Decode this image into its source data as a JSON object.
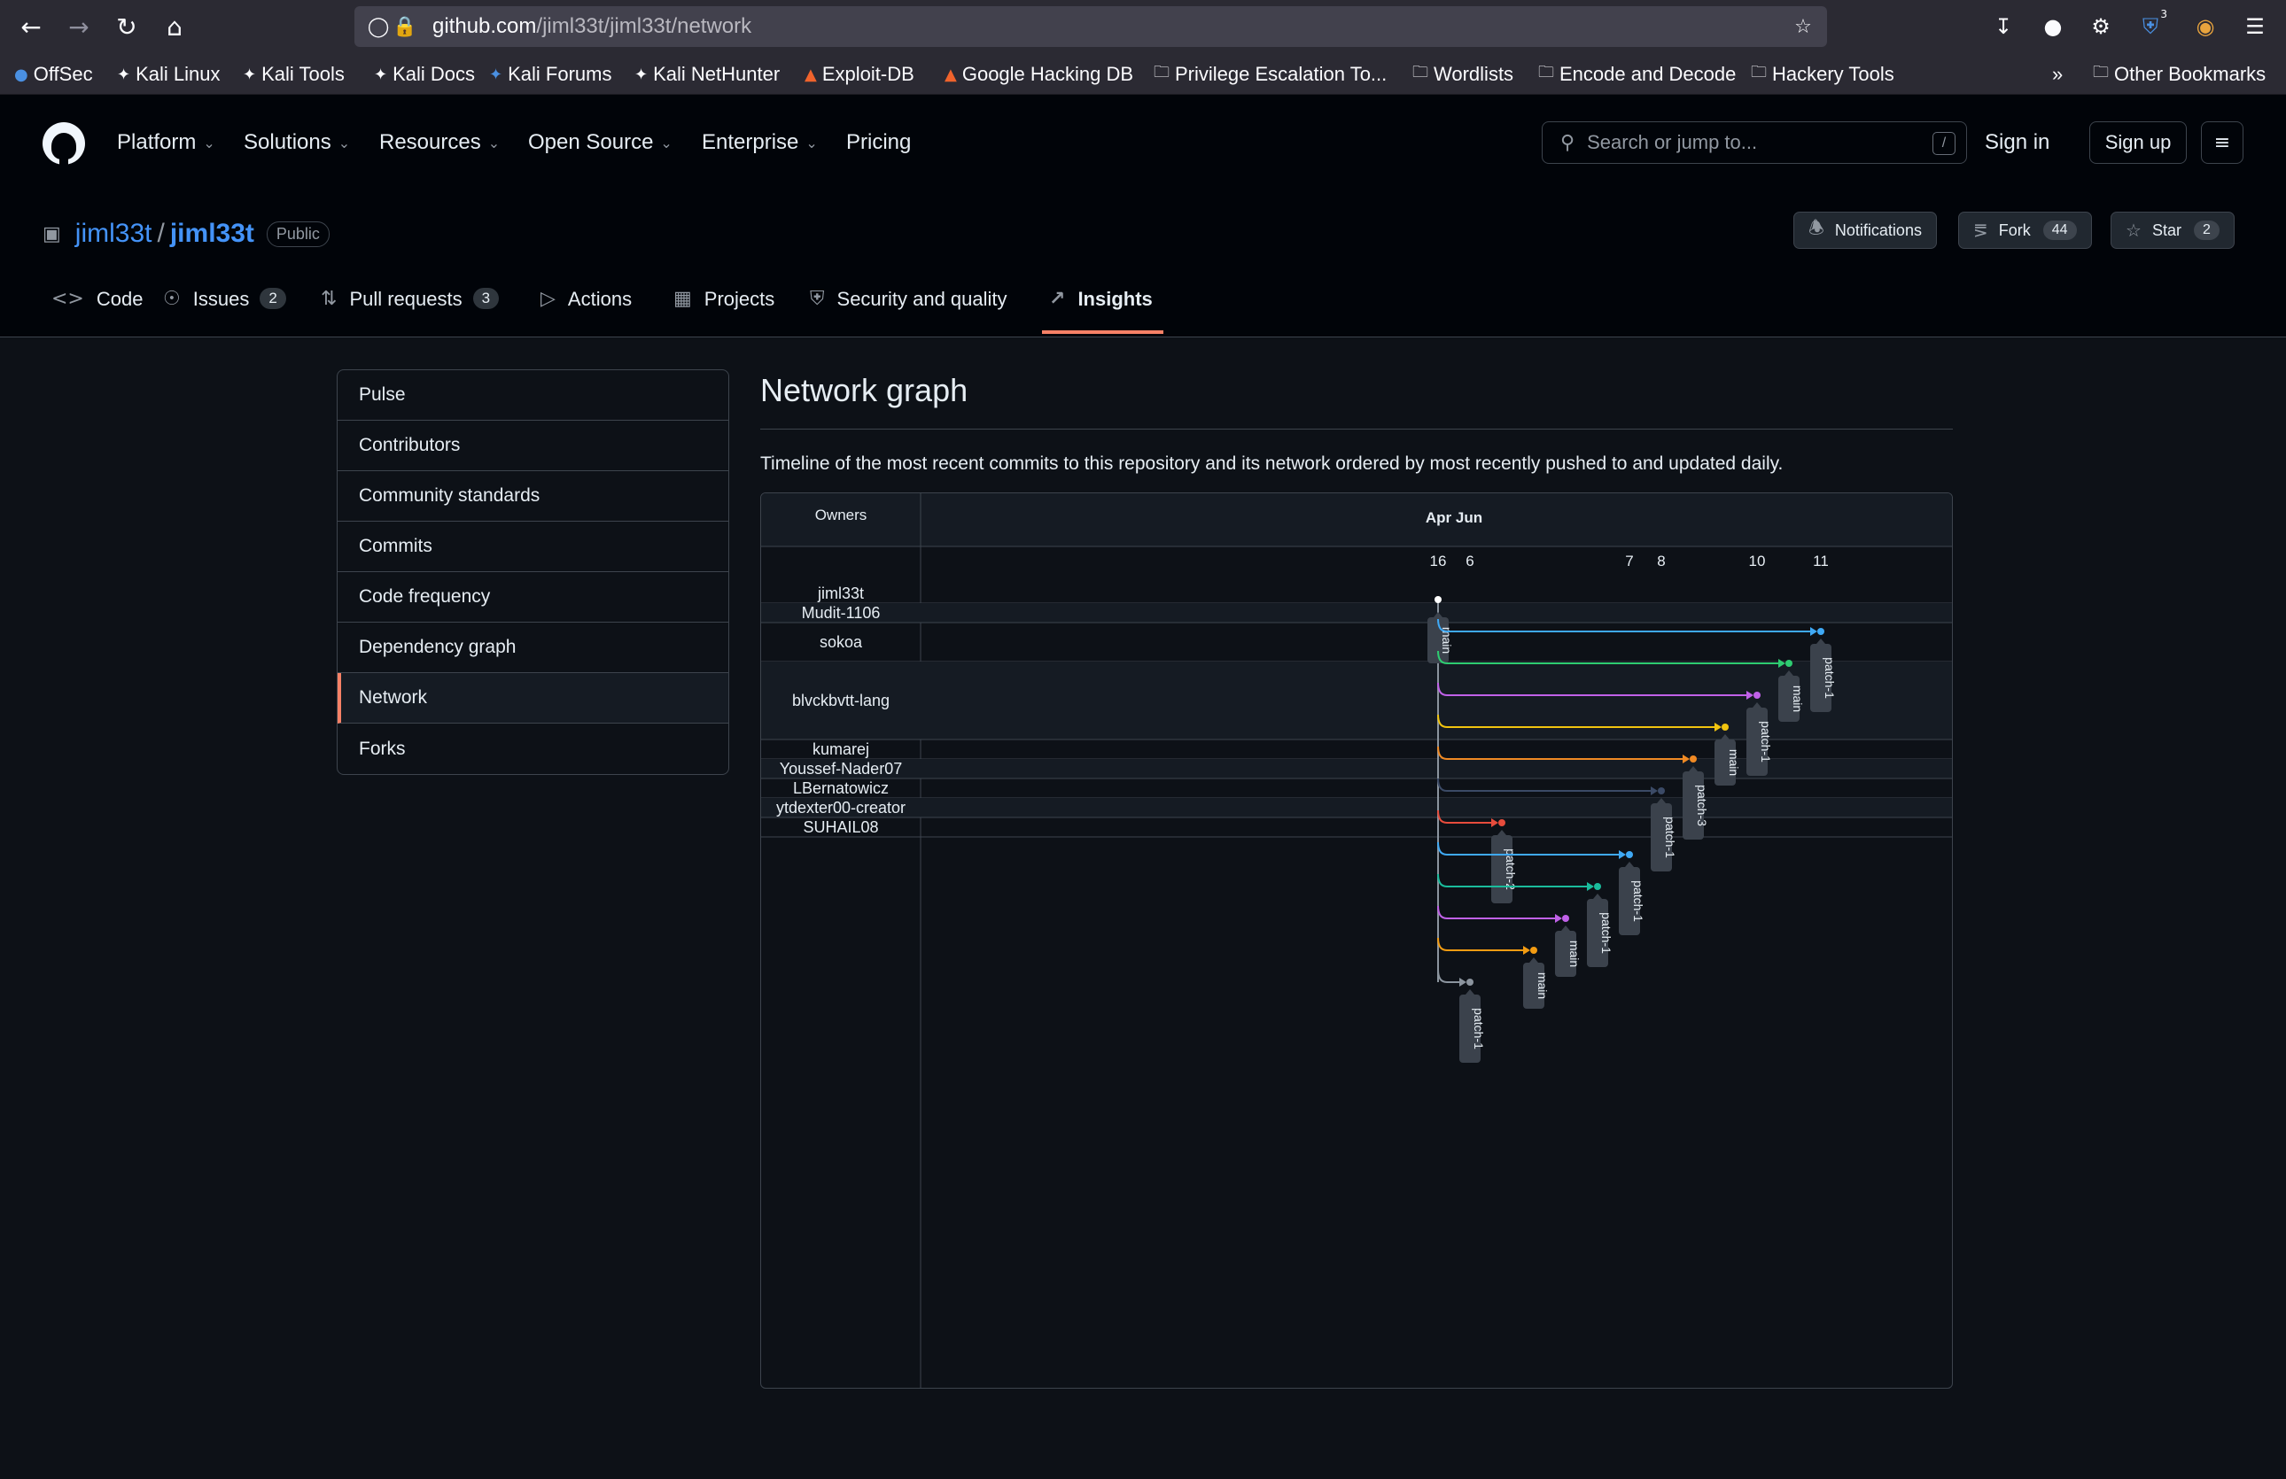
{
  "browser": {
    "url_host": "github.com",
    "url_path": "/jiml33t/jiml33t/network",
    "bookmarks": [
      {
        "label": "OffSec",
        "icon": "globe-icon"
      },
      {
        "label": "Kali Linux",
        "icon": "kali-dragon-icon"
      },
      {
        "label": "Kali Tools",
        "icon": "kali-dragon-icon"
      },
      {
        "label": "Kali Docs",
        "icon": "kali-dragon-icon"
      },
      {
        "label": "Kali Forums",
        "icon": "kali-forums-icon"
      },
      {
        "label": "Kali NetHunter",
        "icon": "kali-dragon-icon"
      },
      {
        "label": "Exploit-DB",
        "icon": "exploit-db-icon"
      },
      {
        "label": "Google Hacking DB",
        "icon": "exploit-db-icon"
      },
      {
        "label": "Privilege Escalation To...",
        "icon": "folder-icon"
      },
      {
        "label": "Wordlists",
        "icon": "folder-icon"
      },
      {
        "label": "Encode and Decode",
        "icon": "folder-icon"
      },
      {
        "label": "Hackery Tools",
        "icon": "folder-icon"
      }
    ],
    "other_bookmarks": "Other Bookmarks",
    "extension_badge": "3"
  },
  "header": {
    "nav": [
      "Platform",
      "Solutions",
      "Resources",
      "Open Source",
      "Enterprise",
      "Pricing"
    ],
    "search_placeholder": "Search or jump to...",
    "search_key": "/",
    "sign_in": "Sign in",
    "sign_up": "Sign up"
  },
  "repo": {
    "owner": "jiml33t",
    "separator": "/",
    "name": "jiml33t",
    "visibility": "Public",
    "notifications_label": "Notifications",
    "fork_label": "Fork",
    "fork_count": "44",
    "star_label": "Star",
    "star_count": "2",
    "tabs": [
      {
        "label": "Code",
        "icon": "code-icon",
        "count": ""
      },
      {
        "label": "Issues",
        "icon": "issue-icon",
        "count": "2"
      },
      {
        "label": "Pull requests",
        "icon": "pull-request-icon",
        "count": "3"
      },
      {
        "label": "Actions",
        "icon": "play-icon",
        "count": ""
      },
      {
        "label": "Projects",
        "icon": "table-icon",
        "count": ""
      },
      {
        "label": "Security and quality",
        "icon": "shield-icon",
        "count": ""
      },
      {
        "label": "Insights",
        "icon": "graph-icon",
        "count": "",
        "active": true
      }
    ]
  },
  "sidebar": {
    "items": [
      "Pulse",
      "Contributors",
      "Community standards",
      "Commits",
      "Code frequency",
      "Dependency graph",
      "Network",
      "Forks"
    ],
    "active": "Network"
  },
  "main": {
    "title": "Network graph",
    "description": "Timeline of the most recent commits to this repository and its network ordered by most recently pushed to and updated daily."
  },
  "chart_data": {
    "type": "network-graph",
    "owners_header": "Owners",
    "months_label": "Apr Jun",
    "day_ticks": [
      "16",
      "6",
      "7",
      "8",
      "10",
      "11"
    ],
    "owners": [
      "jiml33t",
      "Mudit-1106",
      "sokoa",
      "blvckbvtt-lang",
      "kumarej",
      "Youssef-Nader07",
      "LBernatowicz",
      "ytdexter00-creator",
      "SUHAIL08"
    ],
    "root": {
      "owner": "jiml33t",
      "branch": "main",
      "day": "16"
    },
    "branches": [
      {
        "owner": "Mudit-1106",
        "branch": "patch-1",
        "day": "11",
        "color": "#3fa9f5"
      },
      {
        "owner": "sokoa",
        "branch": "main",
        "day": "10b",
        "color": "#2ecc71"
      },
      {
        "owner": "sokoa",
        "branch": "patch-1",
        "day": "10",
        "color": "#c061e8"
      },
      {
        "owner": "blvckbvtt-lang",
        "branch": "main",
        "day": "9",
        "color": "#f1c40f"
      },
      {
        "owner": "blvckbvtt-lang",
        "branch": "patch-3",
        "day": "8b",
        "color": "#f08a24"
      },
      {
        "owner": "blvckbvtt-lang",
        "branch": "patch-1",
        "day": "8",
        "color": "#3b4a66"
      },
      {
        "owner": "blvckbvtt-lang",
        "branch": "patch-2",
        "day": "6b",
        "color": "#e74c3c"
      },
      {
        "owner": "kumarej",
        "branch": "patch-1",
        "day": "7",
        "color": "#3fa9f5"
      },
      {
        "owner": "Youssef-Nader07",
        "branch": "patch-1",
        "day": "6c",
        "color": "#1abc9c"
      },
      {
        "owner": "LBernatowicz",
        "branch": "main",
        "day": "6d",
        "color": "#c061e8"
      },
      {
        "owner": "ytdexter00-creator",
        "branch": "main",
        "day": "6e",
        "color": "#f39c12"
      },
      {
        "owner": "SUHAIL08",
        "branch": "patch-1",
        "day": "6",
        "color": "#8b949e"
      }
    ]
  }
}
